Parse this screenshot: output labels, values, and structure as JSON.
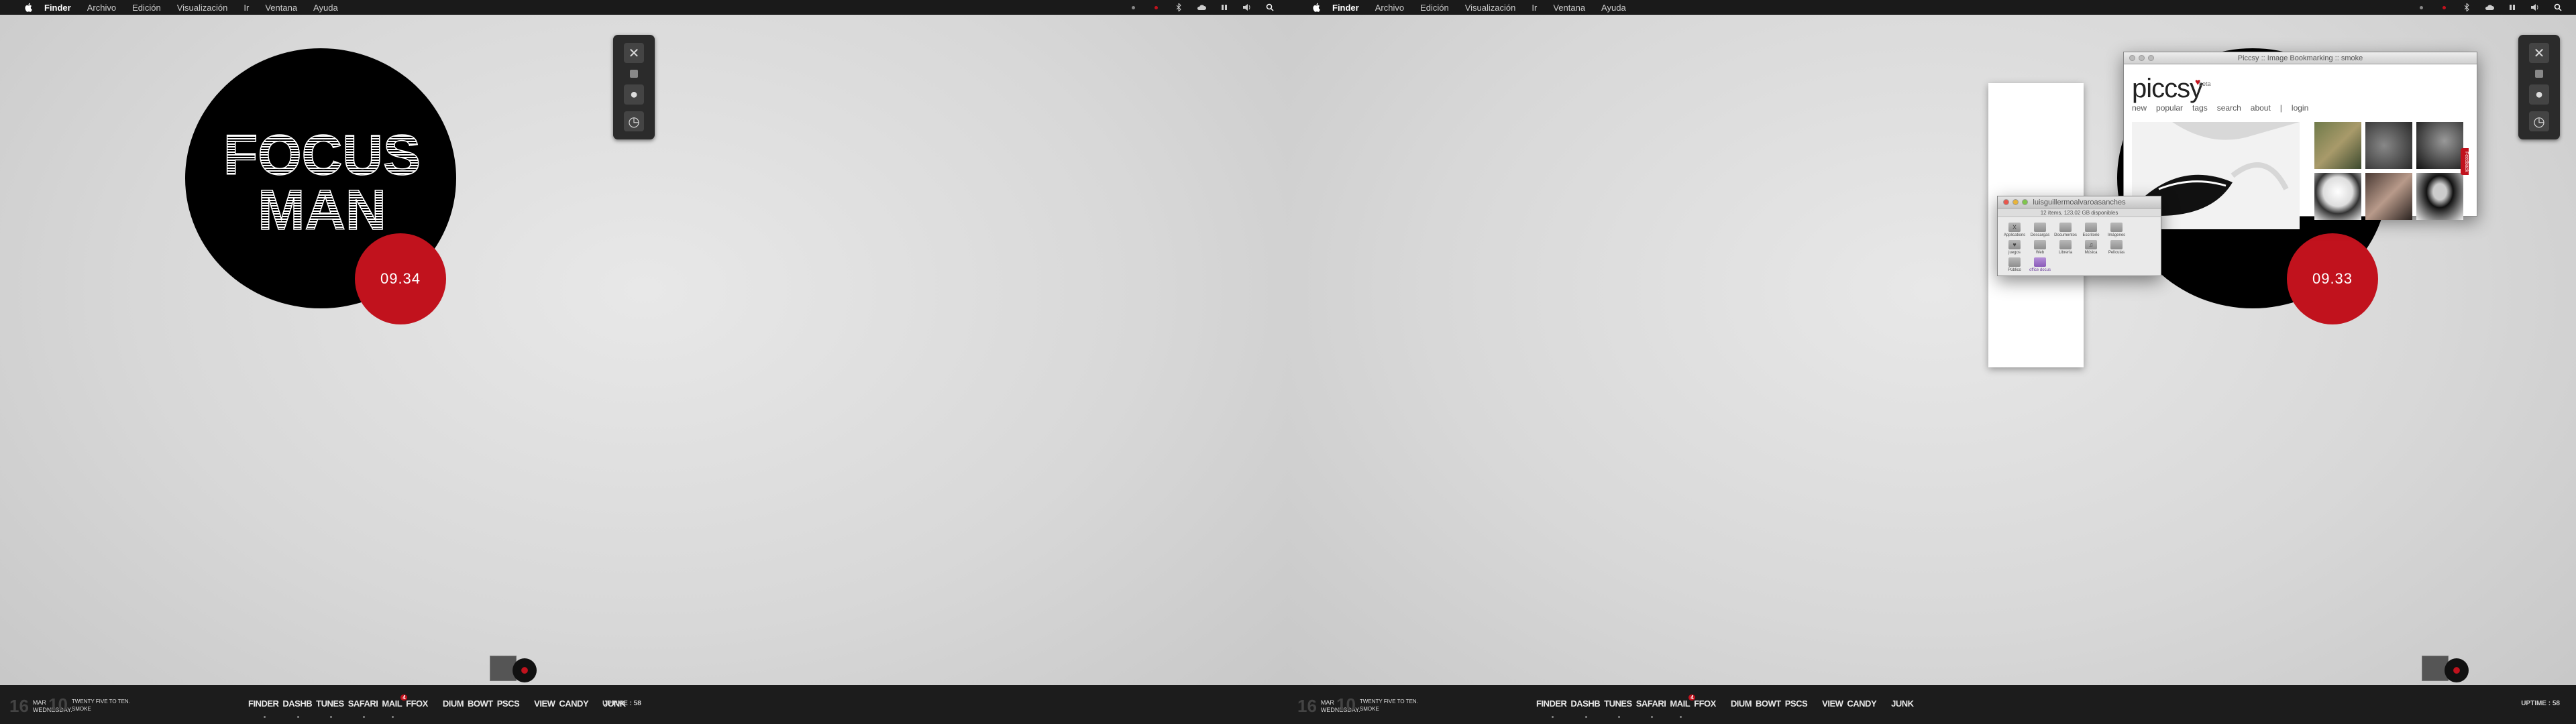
{
  "menubar": {
    "app_name": "Finder",
    "items": [
      "Archivo",
      "Edición",
      "Visualización",
      "Ir",
      "Ventana",
      "Ayuda"
    ]
  },
  "screen1": {
    "poster_text": [
      "FOCUS",
      "MAN"
    ],
    "clock": "09.34"
  },
  "screen2": {
    "clock": "09.33"
  },
  "dock": {
    "day_num": "16",
    "month": "MAR",
    "weekday": "WEDNESDAY.",
    "time_num": "10",
    "time_text": "TWENTY FIVE TO TEN.",
    "time_sub": "SMOKE",
    "apps": [
      "FINDER",
      "DASHB",
      "TUNES",
      "SAFARI",
      "MAIL",
      "FFOX",
      "DIUM",
      "BOWT",
      "PSCS",
      "VIEW",
      "CANDY",
      "JUNK"
    ],
    "mail_badge": "4",
    "uptime": "UPTIME : 58"
  },
  "piccsy": {
    "title": "Piccsy :: Image Bookmarking :: smoke",
    "logo": "piccsy",
    "beta": "beta",
    "nav": [
      "new",
      "popular",
      "tags",
      "search",
      "about",
      "|",
      "login"
    ],
    "feedback": "Feedback"
  },
  "finder": {
    "title": "luisguillermoalvaroasanches",
    "status": "12 ítems, 123,02 GB disponibles",
    "items": [
      "Applications",
      "Descargas",
      "Documentos",
      "Escritorio",
      "Imágenes",
      "juegos",
      "Web",
      "Librería",
      "Música",
      "Películas",
      "Público",
      "office docus"
    ]
  },
  "colors": {
    "accent_red": "#c1121d",
    "menubar_bg": "#1a1a1a",
    "dock_bg": "#1c1c1c"
  }
}
